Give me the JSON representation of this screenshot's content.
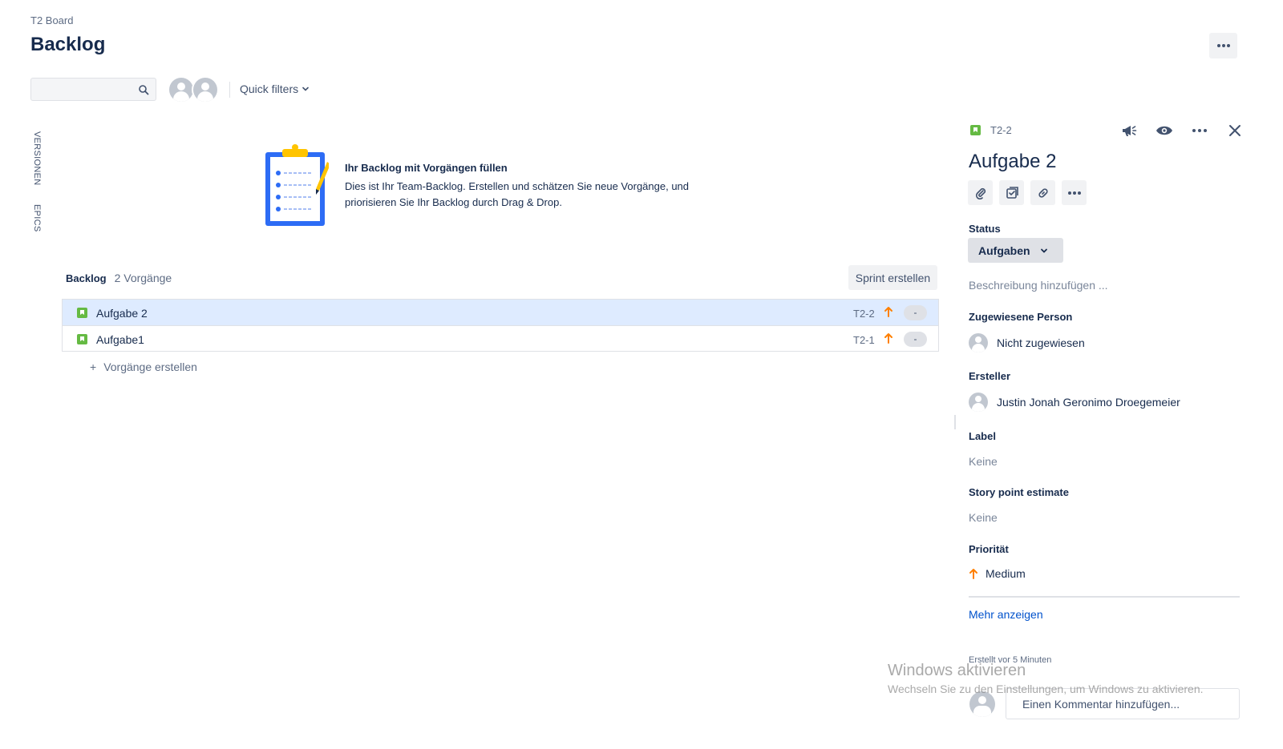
{
  "header": {
    "breadcrumb": "T2 Board",
    "title": "Backlog"
  },
  "toolbar": {
    "search_value": "",
    "quick_filters_label": "Quick filters"
  },
  "side_tabs": {
    "versions": "VERSIONEN",
    "epics": "EPICS"
  },
  "empty_state": {
    "title": "Ihr Backlog mit Vorgängen füllen",
    "body": "Dies ist Ihr Team-Backlog. Erstellen und schätzen Sie neue Vorgänge, und priorisieren Sie Ihr Backlog durch Drag & Drop."
  },
  "backlog": {
    "title": "Backlog",
    "count": "2 Vorgänge",
    "sprint_button": "Sprint erstellen",
    "issues": [
      {
        "summary": "Aufgabe 2",
        "key": "T2-2",
        "estimate": "-",
        "selected": true
      },
      {
        "summary": "Aufgabe1",
        "key": "T2-1",
        "estimate": "-",
        "selected": false
      }
    ],
    "create_label": "Vorgänge erstellen"
  },
  "detail": {
    "key": "T2-2",
    "title": "Aufgabe 2",
    "status_label": "Status",
    "status_value": "Aufgaben",
    "description_placeholder": "Beschreibung hinzufügen ...",
    "assignee_label": "Zugewiesene Person",
    "assignee_value": "Nicht zugewiesen",
    "reporter_label": "Ersteller",
    "reporter_value": "Justin Jonah Geronimo Droegemeier",
    "labels_label": "Label",
    "labels_value": "Keine",
    "story_points_label": "Story point estimate",
    "story_points_value": "Keine",
    "priority_label": "Priorität",
    "priority_value": "Medium",
    "show_more": "Mehr anzeigen",
    "created": "Erstellt vor 5 Minuten",
    "comment_placeholder": "Einen Kommentar hinzufügen..."
  },
  "watermark": {
    "line1": "Windows aktivieren",
    "line2": "Wechseln Sie zu den Einstellungen, um Windows zu aktivieren."
  },
  "colors": {
    "story_green": "#65ba43",
    "priority_orange": "#ff7f00",
    "link_blue": "#0052cc",
    "selected_row": "#deebff",
    "clipboard_blue": "#2d6cf5",
    "clipboard_yellow": "#ffc400"
  }
}
